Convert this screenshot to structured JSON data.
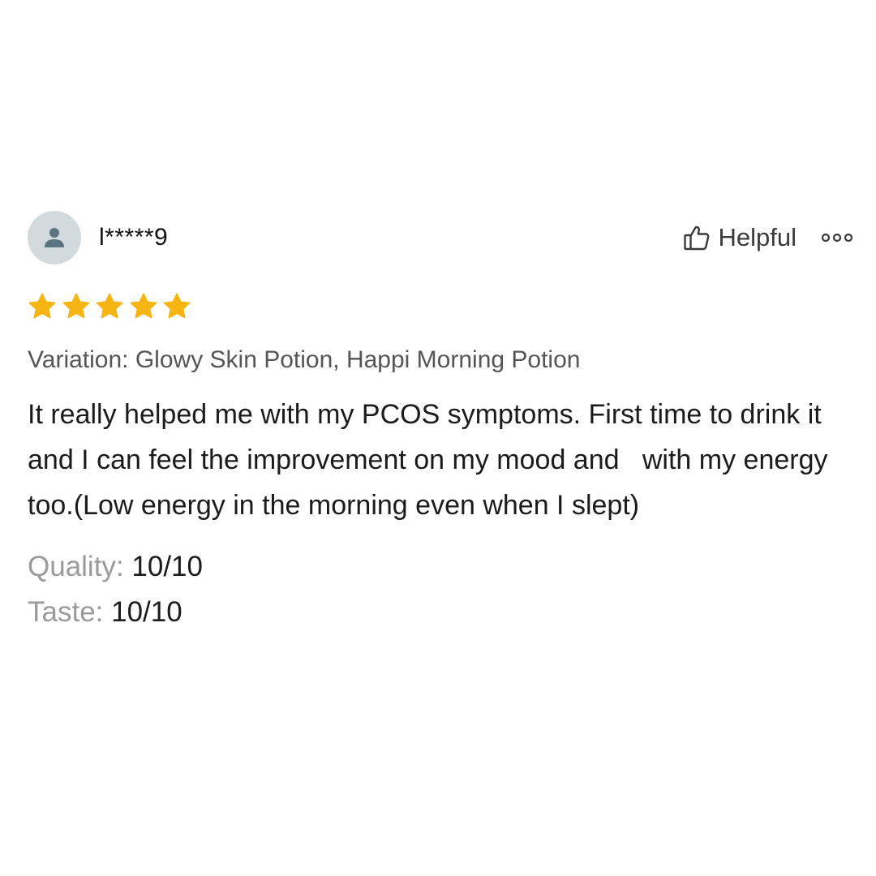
{
  "review": {
    "username": "l*****9",
    "avatar_icon": "user-silhouette-icon",
    "rating": 5,
    "rating_max": 5,
    "star_color": "#f7b514",
    "helpful": {
      "icon": "thumbs-up-icon",
      "label": "Helpful"
    },
    "more_icon": "more-options-icon",
    "variation": "Variation: Glowy Skin Potion, Happi Morning Potion",
    "text": "It really helped me with my PCOS symptoms. First time to drink it and I can feel the improvement on my mood and   with my energy too.(Low energy in the morning even when I slept)",
    "attributes": [
      {
        "label": "Quality: ",
        "value": "10/10"
      },
      {
        "label": "Taste: ",
        "value": "10/10"
      }
    ]
  }
}
